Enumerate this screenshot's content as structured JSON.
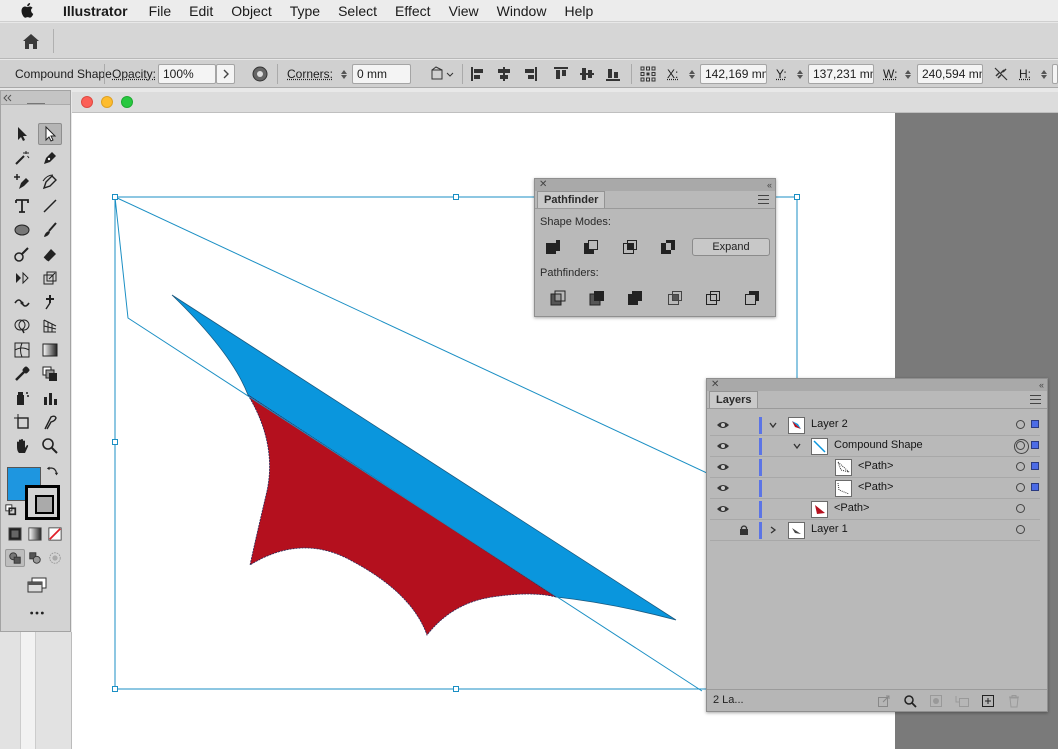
{
  "menubar": {
    "app_name": "Illustrator",
    "items": [
      "File",
      "Edit",
      "Object",
      "Type",
      "Select",
      "Effect",
      "View",
      "Window",
      "Help"
    ]
  },
  "controlbar": {
    "selection_type": "Compound Shape",
    "opacity_label": "Opacity:",
    "opacity_value": "100%",
    "corners_label": "Corners:",
    "corners_value": "0 mm",
    "x_label": "X:",
    "x_value": "142,169 mm",
    "y_label": "Y:",
    "y_value": "137,231 mm",
    "w_label": "W:",
    "w_value": "240,594 mm",
    "h_label": "H:"
  },
  "tools": {
    "fill_color": "#1e96e0",
    "stroke_color": "#000000"
  },
  "pathfinder": {
    "tab_label": "Pathfinder",
    "shape_modes_label": "Shape Modes:",
    "pathfinders_label": "Pathfinders:",
    "expand_label": "Expand"
  },
  "layers": {
    "tab_label": "Layers",
    "rows": [
      {
        "name": "Layer 2"
      },
      {
        "name": "Compound Shape"
      },
      {
        "name": "<Path>"
      },
      {
        "name": "<Path>"
      },
      {
        "name": "<Path>"
      },
      {
        "name": "Layer 1"
      }
    ],
    "footer_count": "2 La..."
  },
  "artwork": {
    "blue_color": "#0a96dd",
    "red_color": "#b4101e",
    "selection_color": "#1b8fc4"
  }
}
